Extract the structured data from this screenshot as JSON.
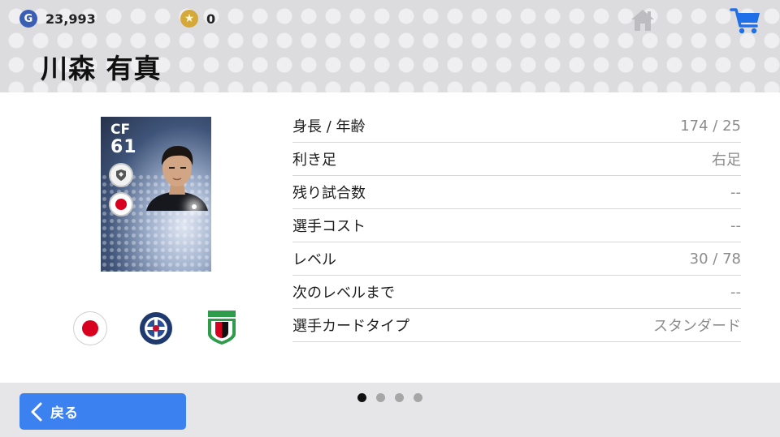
{
  "header": {
    "gp_amount": "23,993",
    "coin_amount": "0",
    "gp_icon_letter": "G",
    "player_name": "川森 有真"
  },
  "card": {
    "position": "CF",
    "overall": "61"
  },
  "stats": [
    {
      "label": "身長 / 年齢",
      "value": "174 / 25"
    },
    {
      "label": "利き足",
      "value": "右足"
    },
    {
      "label": "残り試合数",
      "value": "--"
    },
    {
      "label": "選手コスト",
      "value": "--"
    },
    {
      "label": "レベル",
      "value": "30 / 78"
    },
    {
      "label": "次のレベルまで",
      "value": "--"
    },
    {
      "label": "選手カードタイプ",
      "value": "スタンダード"
    }
  ],
  "pager": {
    "pages": 4,
    "current": 1
  },
  "footer": {
    "back_label": "戻る"
  },
  "colors": {
    "accent_blue": "#3b82f0",
    "cart_blue": "#1e6fe8",
    "gp_blue": "#3b5fb5",
    "coin_gold": "#d4a93a",
    "flag_red": "#d7001e"
  },
  "icons": {
    "gp": "gp-coin-icon",
    "coin": "star-coin-icon",
    "home": "home-icon",
    "cart": "cart-icon",
    "back": "chevron-left-icon"
  }
}
